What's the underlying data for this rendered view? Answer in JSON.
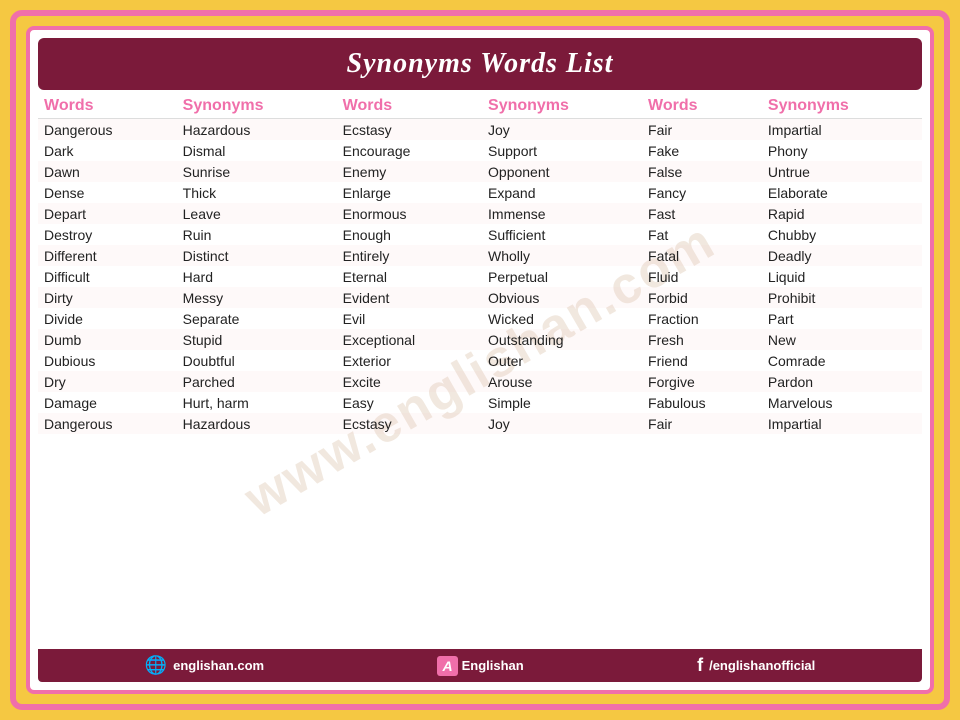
{
  "title": "Synonyms Words List",
  "columns": [
    {
      "header": "Words",
      "key": "w1"
    },
    {
      "header": "Synonyms",
      "key": "s1"
    },
    {
      "header": "Words",
      "key": "w2"
    },
    {
      "header": "Synonyms",
      "key": "s2"
    },
    {
      "header": "Words",
      "key": "w3"
    },
    {
      "header": "Synonyms",
      "key": "s3"
    }
  ],
  "rows": [
    {
      "w1": "Dangerous",
      "s1": "Hazardous",
      "w2": "Ecstasy",
      "s2": "Joy",
      "w3": "Fair",
      "s3": "Impartial"
    },
    {
      "w1": "Dark",
      "s1": "Dismal",
      "w2": "Encourage",
      "s2": "Support",
      "w3": "Fake",
      "s3": "Phony"
    },
    {
      "w1": "Dawn",
      "s1": "Sunrise",
      "w2": "Enemy",
      "s2": "Opponent",
      "w3": "False",
      "s3": "Untrue"
    },
    {
      "w1": "Dense",
      "s1": "Thick",
      "w2": "Enlarge",
      "s2": "Expand",
      "w3": "Fancy",
      "s3": "Elaborate"
    },
    {
      "w1": "Depart",
      "s1": "Leave",
      "w2": "Enormous",
      "s2": "Immense",
      "w3": "Fast",
      "s3": "Rapid"
    },
    {
      "w1": "Destroy",
      "s1": "Ruin",
      "w2": "Enough",
      "s2": "Sufficient",
      "w3": "Fat",
      "s3": "Chubby"
    },
    {
      "w1": "Different",
      "s1": "Distinct",
      "w2": "Entirely",
      "s2": "Wholly",
      "w3": "Fatal",
      "s3": "Deadly"
    },
    {
      "w1": "Difficult",
      "s1": "Hard",
      "w2": "Eternal",
      "s2": "Perpetual",
      "w3": "Fluid",
      "s3": "Liquid"
    },
    {
      "w1": "Dirty",
      "s1": "Messy",
      "w2": "Evident",
      "s2": "Obvious",
      "w3": "Forbid",
      "s3": "Prohibit"
    },
    {
      "w1": "Divide",
      "s1": "Separate",
      "w2": "Evil",
      "s2": "Wicked",
      "w3": "Fraction",
      "s3": "Part"
    },
    {
      "w1": "Dumb",
      "s1": "Stupid",
      "w2": "Exceptional",
      "s2": "Outstanding",
      "w3": "Fresh",
      "s3": "New"
    },
    {
      "w1": "Dubious",
      "s1": "Doubtful",
      "w2": "Exterior",
      "s2": "Outer",
      "w3": "Friend",
      "s3": "Comrade"
    },
    {
      "w1": "Dry",
      "s1": "Parched",
      "w2": "Excite",
      "s2": "Arouse",
      "w3": "Forgive",
      "s3": "Pardon"
    },
    {
      "w1": "Damage",
      "s1": "Hurt, harm",
      "w2": "Easy",
      "s2": "Simple",
      "w3": "Fabulous",
      "s3": "Marvelous"
    },
    {
      "w1": "Dangerous",
      "s1": "Hazardous",
      "w2": "Ecstasy",
      "s2": "Joy",
      "w3": "Fair",
      "s3": "Impartial"
    }
  ],
  "footer": {
    "website": "englishan.com",
    "brand": "Englishan",
    "social": "/englishanofficial"
  },
  "watermark": "www.englishan.com"
}
